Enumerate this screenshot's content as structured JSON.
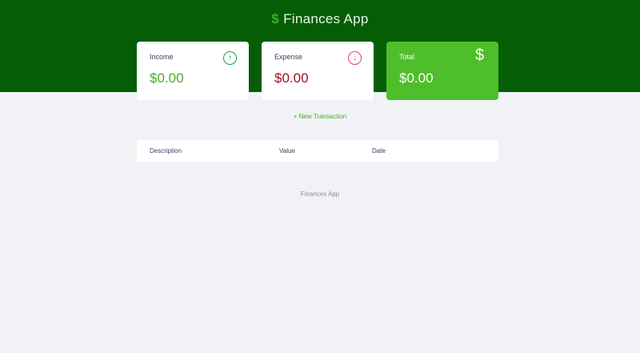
{
  "header": {
    "logo_symbol": "$",
    "title": "Finances App"
  },
  "cards": [
    {
      "label": "Income",
      "value": "$0.00",
      "icon": "arrow-up-circle-icon",
      "color": "#49aa26",
      "icon_glyph": "↑"
    },
    {
      "label": "Expense",
      "value": "$0.00",
      "icon": "arrow-down-circle-icon",
      "color": "#b01a26",
      "icon_glyph": "↓"
    },
    {
      "label": "Total",
      "value": "$0.00",
      "icon": "dollar-icon",
      "icon_glyph": "$"
    }
  ],
  "new_transaction": "+ New Transaction",
  "table": {
    "columns": [
      "Description",
      "Value",
      "Date"
    ]
  },
  "footer": "Finances App"
}
